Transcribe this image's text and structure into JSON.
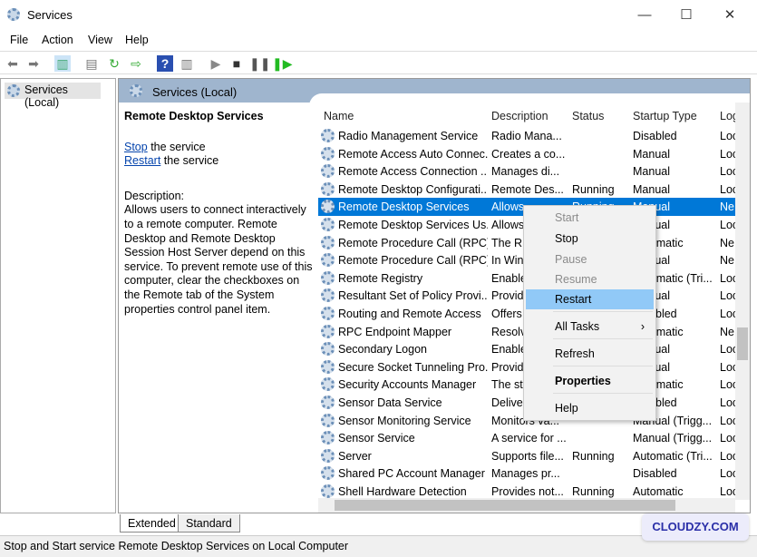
{
  "window": {
    "title": "Services",
    "minimize": "—",
    "maximize": "☐",
    "close": "✕"
  },
  "menu": [
    "File",
    "Action",
    "View",
    "Help"
  ],
  "toolbar": [
    "back-icon",
    "forward-icon",
    "show-hide-tree-icon",
    "properties-icon",
    "refresh-icon",
    "export-icon",
    "help-icon",
    "console-icon",
    "start-icon",
    "stop-icon",
    "pause-icon",
    "resume-icon"
  ],
  "tree": {
    "item": "Services (Local)"
  },
  "pane": {
    "title": "Services (Local)"
  },
  "details": {
    "name": "Remote Desktop Services",
    "stop_link": "Stop",
    "stop_suffix": " the service",
    "restart_link": "Restart",
    "restart_suffix": " the service",
    "desc_label": "Description:",
    "desc_text": "Allows users to connect interactively to a remote computer. Remote Desktop and Remote Desktop Session Host Server depend on this service. To prevent remote use of this computer, clear the checkboxes on the Remote tab of the System properties control panel item."
  },
  "columns": [
    "Name",
    "Description",
    "Status",
    "Startup Type",
    "Log"
  ],
  "rows": [
    [
      "Radio Management Service",
      "Radio Mana...",
      "",
      "Disabled",
      "Loc"
    ],
    [
      "Remote Access Auto Connec...",
      "Creates a co...",
      "",
      "Manual",
      "Loc"
    ],
    [
      "Remote Access Connection ...",
      "Manages di...",
      "",
      "Manual",
      "Loc"
    ],
    [
      "Remote Desktop Configurati...",
      "Remote Des...",
      "Running",
      "Manual",
      "Loc"
    ],
    [
      "Remote Desktop Services",
      "Allows",
      "Running",
      "Manual",
      "Ne"
    ],
    [
      "Remote Desktop Services Us...",
      "Allows",
      "",
      "Manual",
      "Loc"
    ],
    [
      "Remote Procedure Call (RPC)",
      "The RP",
      "",
      "Automatic",
      "Ne"
    ],
    [
      "Remote Procedure Call (RPC)...",
      "In Win",
      "",
      "Manual",
      "Ne"
    ],
    [
      "Remote Registry",
      "Enable",
      "",
      "Automatic (Tri...",
      "Loc"
    ],
    [
      "Resultant Set of Policy Provi...",
      "Provid",
      "",
      "Manual",
      "Loc"
    ],
    [
      "Routing and Remote Access",
      "Offers",
      "",
      "Disabled",
      "Loc"
    ],
    [
      "RPC Endpoint Mapper",
      "Resolv",
      "",
      "Automatic",
      "Ne"
    ],
    [
      "Secondary Logon",
      "Enable",
      "",
      "Manual",
      "Loc"
    ],
    [
      "Secure Socket Tunneling Pro...",
      "Provid",
      "",
      "Manual",
      "Loc"
    ],
    [
      "Security Accounts Manager",
      "The st",
      "",
      "Automatic",
      "Loc"
    ],
    [
      "Sensor Data Service",
      "Delive",
      "",
      "Disabled",
      "Loc"
    ],
    [
      "Sensor Monitoring Service",
      "Monitors va...",
      "",
      "Manual (Trigg...",
      "Loc"
    ],
    [
      "Sensor Service",
      "A service for ...",
      "",
      "Manual (Trigg...",
      "Loc"
    ],
    [
      "Server",
      "Supports file...",
      "Running",
      "Automatic (Tri...",
      "Loc"
    ],
    [
      "Shared PC Account Manager",
      "Manages pr...",
      "",
      "Disabled",
      "Loc"
    ],
    [
      "Shell Hardware Detection",
      "Provides not...",
      "Running",
      "Automatic",
      "Loc"
    ]
  ],
  "selected_row": 4,
  "context_menu": {
    "start": "Start",
    "stop": "Stop",
    "pause": "Pause",
    "resume": "Resume",
    "restart": "Restart",
    "all_tasks": "All Tasks",
    "submenu_arrow": "›",
    "refresh": "Refresh",
    "properties": "Properties",
    "help": "Help"
  },
  "tabs": [
    "Extended",
    "Standard"
  ],
  "status": "Stop and Start service Remote Desktop Services on Local Computer",
  "watermark": "CLOUDZY.COM",
  "colors": {
    "selection": "#0078d7",
    "menu_highlight": "#91c9f7",
    "band": "#9fb5ce"
  }
}
